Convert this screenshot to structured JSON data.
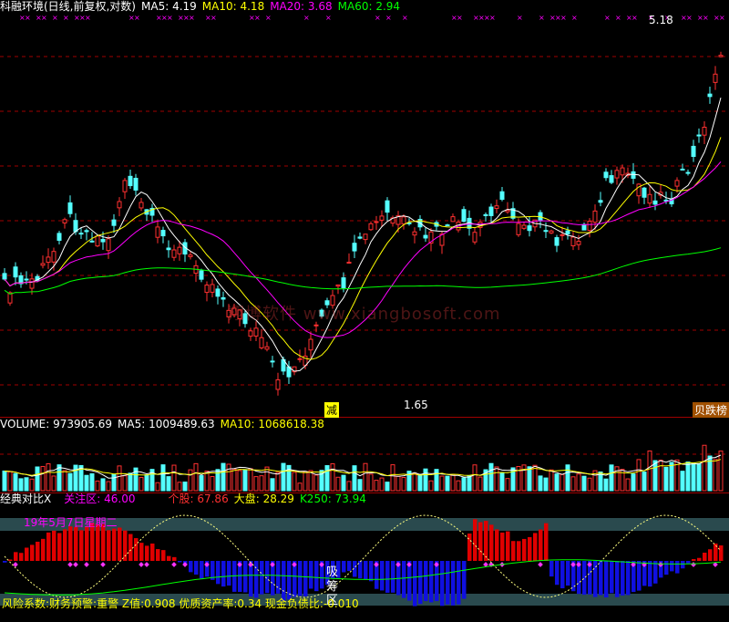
{
  "main": {
    "title": "科融环境(日线,前复权,对数)",
    "ma_labels": [
      {
        "name": "MA5",
        "value": "4.19",
        "color": "#ffffff"
      },
      {
        "name": "MA10",
        "value": "4.18",
        "color": "#ffff00"
      },
      {
        "name": "MA20",
        "value": "3.68",
        "color": "#ff00ff"
      },
      {
        "name": "MA60",
        "value": "2.94",
        "color": "#00ff00"
      }
    ],
    "high_label": "5.18",
    "low_label": "1.65",
    "tag_jian": "减",
    "tag_right": "贝跌榜",
    "watermark": "翔博软件 www.xiangbosoft.com"
  },
  "volume": {
    "label": "VOLUME",
    "value": "973905.69",
    "ma5_label": "MA5",
    "ma5_value": "1009489.63",
    "ma10_label": "MA10",
    "ma10_value": "1068618.38"
  },
  "indicator": {
    "name": "经典对比X",
    "focus_label": "关注区",
    "focus_value": "46.00",
    "stock_label": "个股",
    "stock_value": "67.86",
    "market_label": "大盘",
    "market_value": "28.29",
    "k250_label": "K250",
    "k250_value": "73.94",
    "date_text": "19年5月7日星期二",
    "zone_text_1": "吸",
    "zone_text_2": "筹",
    "zone_text_3": "区",
    "footer": "风险系数:财务预警:重警 Z值:0.908 优质资产率:0.34 现金负债比:-0.010"
  },
  "colors": {
    "up": "#ff3030",
    "down": "#54ffff",
    "ma5": "#ffffff",
    "ma10": "#ffff00",
    "ma20": "#ff00ff",
    "ma60": "#00ff00",
    "grid": "#a00000"
  }
}
